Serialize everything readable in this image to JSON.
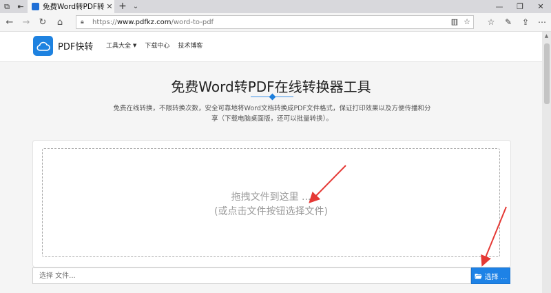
{
  "browser": {
    "tab_title": "免费Word转PDF转换器",
    "url_scheme": "https://",
    "url_host": "www.pdfkz.com",
    "url_path": "/word-to-pdf"
  },
  "site": {
    "logo_text": "PDF快转",
    "nav": [
      {
        "label": "工具大全",
        "has_caret": true
      },
      {
        "label": "下载中心"
      },
      {
        "label": "技术博客"
      }
    ]
  },
  "hero": {
    "title": "免费Word转PDF在线转换器工具",
    "description_line1": "免费在线转换，不限转换次数，安全可靠地将Word文档转换成PDF文件格式，保证打印效果以及方便传播和分",
    "description_line2": "享（下载电脑桌面版，还可以批量转换）。"
  },
  "upload": {
    "drop_line1": "拖拽文件到这里 ...",
    "drop_line2": "(或点击文件按钮选择文件)",
    "input_placeholder": "选择 文件...",
    "choose_button": "选择 ..."
  },
  "colors": {
    "accent": "#1e82e6",
    "annotation_arrow": "#e53935"
  }
}
